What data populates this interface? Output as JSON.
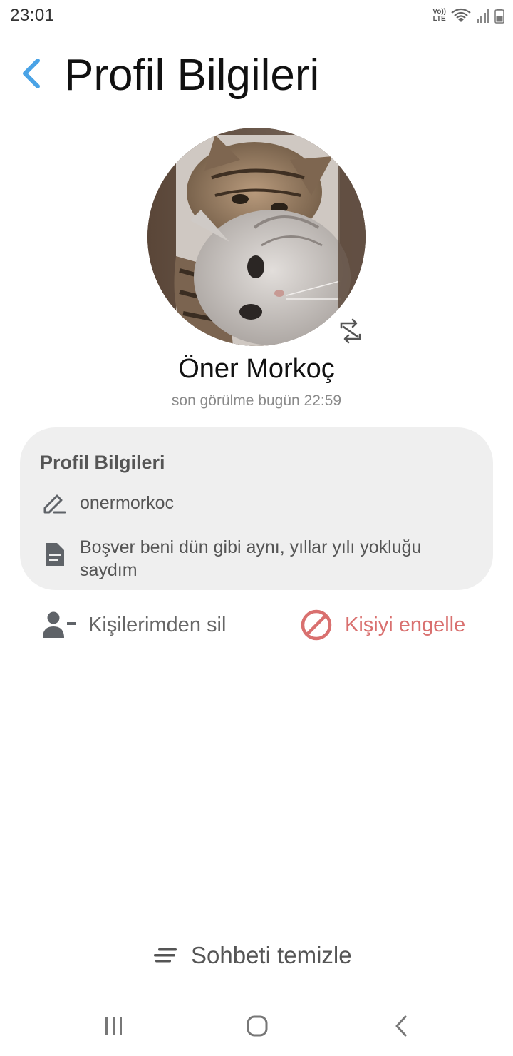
{
  "status_bar": {
    "time": "23:01",
    "volte_top": "Vo))",
    "volte_bottom": "LTE"
  },
  "header": {
    "title": "Profil Bilgileri"
  },
  "profile": {
    "name": "Öner Morkoç",
    "last_seen": "son görülme bugün 22:59"
  },
  "info_card": {
    "title": "Profil Bilgileri",
    "username": "onermorkoc",
    "about": "Boşver beni dün gibi aynı, yıllar yılı yokluğu saydım"
  },
  "actions": {
    "remove_contact": "Kişilerimden sil",
    "block_contact": "Kişiyi engelle"
  },
  "footer": {
    "clear_chat": "Sohbeti temizle"
  },
  "colors": {
    "accent_blue": "#4aa3e6",
    "danger_red": "#d9706f",
    "card_bg": "#efefef",
    "icon_gray": "#5f6368"
  },
  "icons": {
    "back": "chevron-left-icon",
    "rotate": "rotate-icon",
    "username": "pencil-icon",
    "about": "document-icon",
    "remove": "person-remove-icon",
    "block": "block-icon",
    "clear": "lines-icon"
  }
}
